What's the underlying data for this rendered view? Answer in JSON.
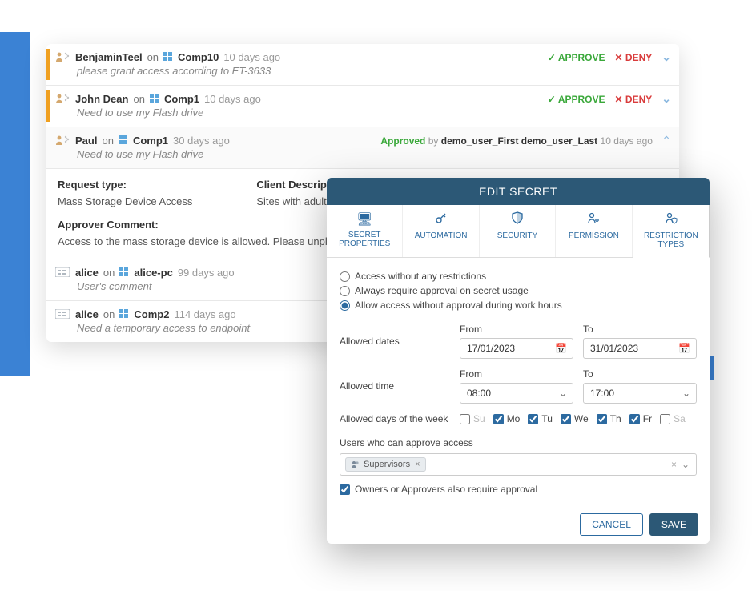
{
  "requests": [
    {
      "user": "BenjaminTeel",
      "on": "on",
      "host": "Comp10",
      "age": "10 days ago",
      "msg": "please grant access according to ET-3633",
      "approve": "APPROVE",
      "deny": "DENY",
      "icon": "person"
    },
    {
      "user": "John Dean",
      "on": "on",
      "host": "Comp1",
      "age": "10 days ago",
      "msg": "Need to use my Flash drive",
      "approve": "APPROVE",
      "deny": "DENY",
      "icon": "person"
    },
    {
      "user": "Paul",
      "on": "on",
      "host": "Comp1",
      "age": "30 days ago",
      "msg": "Need to use my Flash drive",
      "status_approved": "Approved",
      "status_by": "by",
      "status_who": "demo_user_First demo_user_Last",
      "status_age": "10 days ago",
      "icon": "person"
    },
    {
      "user": "alice",
      "on": "on",
      "host": "alice-pc",
      "age": "99 days ago",
      "msg": "User's comment",
      "icon": "card"
    },
    {
      "user": "alice",
      "on": "on",
      "host": "Comp2",
      "age": "114 days ago",
      "msg": "Need a temporary access to endpoint",
      "icon": "card"
    }
  ],
  "details": {
    "req_type_lbl": "Request type:",
    "req_type_val": "Mass Storage Device Access",
    "client_desc_lbl": "Client Description:",
    "client_desc_val": "Sites with adult content",
    "approver_lbl": "Approver Comment:",
    "approver_txt": "Access to the mass storage device is allowed. Please unplug the m"
  },
  "modal": {
    "title": "EDIT SECRET",
    "tabs": {
      "secret": "SECRET PROPERTIES",
      "automation": "AUTOMATION",
      "security": "SECURITY",
      "permission": "PERMISSION",
      "restriction": "RESTRICTION TYPES"
    },
    "radios": {
      "r1": "Access without any restrictions",
      "r2": "Always require approval on secret usage",
      "r3": "Allow access without approval during work hours"
    },
    "allowed_dates_lbl": "Allowed dates",
    "allowed_time_lbl": "Allowed time",
    "from_lbl": "From",
    "to_lbl": "To",
    "date_from": "17/01/2023",
    "date_to": "31/01/2023",
    "time_from": "08:00",
    "time_to": "17:00",
    "days_lbl": "Allowed days of the week",
    "days": {
      "su": "Su",
      "mo": "Mo",
      "tu": "Tu",
      "we": "We",
      "th": "Th",
      "fr": "Fr",
      "sa": "Sa"
    },
    "users_lbl": "Users who can approve access",
    "tag": "Supervisors",
    "owners_lbl": "Owners or Approvers also require approval",
    "cancel": "CANCEL",
    "save": "SAVE"
  }
}
